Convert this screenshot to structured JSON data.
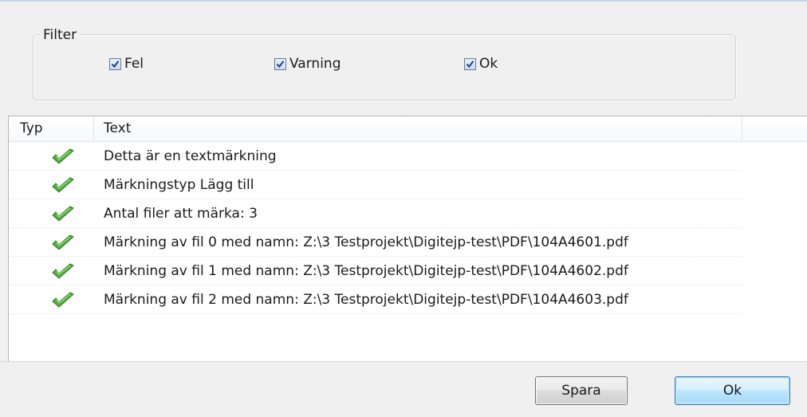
{
  "filter": {
    "title": "Filter",
    "checkboxes": [
      {
        "label": "Fel",
        "checked": true
      },
      {
        "label": "Varning",
        "checked": true
      },
      {
        "label": "Ok",
        "checked": true
      }
    ]
  },
  "list": {
    "columns": [
      "Typ",
      "Text"
    ],
    "rows": [
      {
        "type_icon": "ok-check-icon",
        "text": "Detta är en textmärkning"
      },
      {
        "type_icon": "ok-check-icon",
        "text": "Märkningstyp Lägg till"
      },
      {
        "type_icon": "ok-check-icon",
        "text": "Antal filer att märka: 3"
      },
      {
        "type_icon": "ok-check-icon",
        "text": "Märkning av fil 0 med namn: Z:\\3 Testprojekt\\Digitejp-test\\PDF\\104A4601.pdf"
      },
      {
        "type_icon": "ok-check-icon",
        "text": "Märkning av fil 1 med namn: Z:\\3 Testprojekt\\Digitejp-test\\PDF\\104A4602.pdf"
      },
      {
        "type_icon": "ok-check-icon",
        "text": "Märkning av fil 2 med namn: Z:\\3 Testprojekt\\Digitejp-test\\PDF\\104A4603.pdf"
      }
    ]
  },
  "buttons": {
    "save_label": "Spara",
    "ok_label": "Ok"
  },
  "colors": {
    "check_green": "#4fb03a",
    "checkbox_tick": "#1c3f8f",
    "ok_button_border": "#3c7fb1"
  }
}
